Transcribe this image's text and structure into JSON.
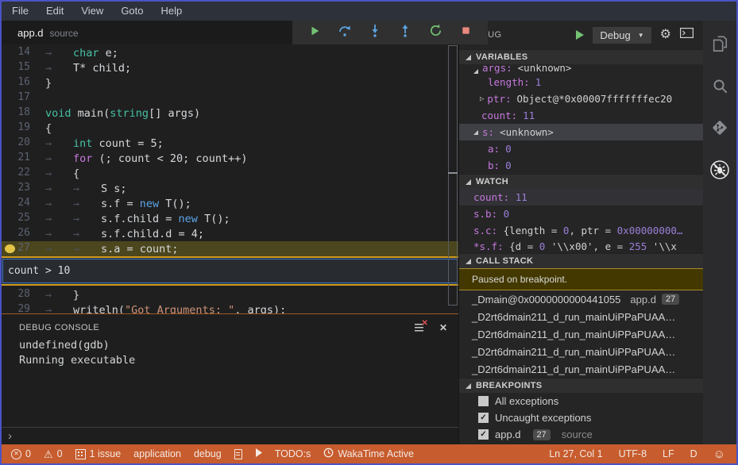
{
  "menubar": {
    "items": [
      "File",
      "Edit",
      "View",
      "Goto",
      "Help"
    ]
  },
  "editor": {
    "tab": {
      "file": "app.d",
      "mode": "source"
    },
    "toolbar_buttons": [
      {
        "name": "continue-button",
        "icon": "debug-continue-icon"
      },
      {
        "name": "step-over-button",
        "icon": "debug-step-over-icon"
      },
      {
        "name": "step-into-button",
        "icon": "debug-step-into-icon"
      },
      {
        "name": "step-out-button",
        "icon": "debug-step-out-icon"
      },
      {
        "name": "restart-button",
        "icon": "debug-restart-icon"
      },
      {
        "name": "stop-button",
        "icon": "debug-stop-icon"
      }
    ],
    "breakpoint_condition": "count > 10",
    "lines": [
      {
        "n": 14,
        "tabs": 1,
        "tokens": [
          {
            "t": "char",
            "c": "type"
          },
          {
            "t": " e;",
            "c": "plain"
          }
        ]
      },
      {
        "n": 15,
        "tabs": 1,
        "tokens": [
          {
            "t": "T* child;",
            "c": "plain"
          }
        ]
      },
      {
        "n": 16,
        "tabs": 0,
        "tokens": [
          {
            "t": "}",
            "c": "plain"
          }
        ]
      },
      {
        "n": 17,
        "tabs": 0,
        "tokens": []
      },
      {
        "n": 18,
        "tabs": 0,
        "tokens": [
          {
            "t": "void",
            "c": "type"
          },
          {
            "t": " main(",
            "c": "plain"
          },
          {
            "t": "string",
            "c": "type"
          },
          {
            "t": "[] args)",
            "c": "plain"
          }
        ]
      },
      {
        "n": 19,
        "tabs": 0,
        "tokens": [
          {
            "t": "{",
            "c": "plain"
          }
        ]
      },
      {
        "n": 20,
        "tabs": 1,
        "tokens": [
          {
            "t": "int",
            "c": "type"
          },
          {
            "t": " count = 5;",
            "c": "plain"
          }
        ]
      },
      {
        "n": 21,
        "tabs": 1,
        "tokens": [
          {
            "t": "for",
            "c": "ctrl"
          },
          {
            "t": " (; count < 20; count++)",
            "c": "plain"
          }
        ]
      },
      {
        "n": 22,
        "tabs": 1,
        "tokens": [
          {
            "t": "{",
            "c": "plain"
          }
        ]
      },
      {
        "n": 23,
        "tabs": 2,
        "tokens": [
          {
            "t": "S s;",
            "c": "plain"
          }
        ]
      },
      {
        "n": 24,
        "tabs": 2,
        "tokens": [
          {
            "t": "s.f = ",
            "c": "plain"
          },
          {
            "t": "new",
            "c": "new"
          },
          {
            "t": " T();",
            "c": "plain"
          }
        ]
      },
      {
        "n": 25,
        "tabs": 2,
        "tokens": [
          {
            "t": "s.f.child = ",
            "c": "plain"
          },
          {
            "t": "new",
            "c": "new"
          },
          {
            "t": " T();",
            "c": "plain"
          }
        ]
      },
      {
        "n": 26,
        "tabs": 2,
        "tokens": [
          {
            "t": "s.f.child.d = 4;",
            "c": "plain"
          }
        ]
      },
      {
        "n": 27,
        "tabs": 2,
        "current": true,
        "breakpoint": true,
        "tokens": [
          {
            "t": "s.a = count;",
            "c": "plain"
          }
        ]
      },
      {
        "n": 28,
        "tabs": 1,
        "tokens": [
          {
            "t": "}",
            "c": "plain"
          }
        ]
      },
      {
        "n": 29,
        "tabs": 1,
        "tokens": [
          {
            "t": "writeln(",
            "c": "plain"
          },
          {
            "t": "\"Got Arguments: \"",
            "c": "str"
          },
          {
            "t": ", args);",
            "c": "plain"
          }
        ]
      }
    ]
  },
  "debug_panel": {
    "title": "DEBUG",
    "configuration": "Debug",
    "variables": {
      "title": "VARIABLES",
      "rows": [
        {
          "name": "args",
          "value": "<unknown>",
          "num": false,
          "indent": 0,
          "twisty": "open",
          "clipped": true
        },
        {
          "name": "length",
          "value": "1",
          "num": true,
          "indent": 1
        },
        {
          "name": "ptr",
          "value": "Object@*0x00007fffffffec20",
          "num": false,
          "indent": 1,
          "twisty": "closed"
        },
        {
          "name": "count",
          "value": "11",
          "num": true,
          "indent": 0
        },
        {
          "name": "s",
          "value": "<unknown>",
          "num": false,
          "indent": 0,
          "twisty": "open",
          "selected": true
        },
        {
          "name": "a",
          "value": "0",
          "num": true,
          "indent": 1
        },
        {
          "name": "b",
          "value": "0",
          "num": true,
          "indent": 1
        }
      ]
    },
    "watch": {
      "title": "WATCH",
      "rows": [
        {
          "name": "count",
          "parts": [
            {
              "t": "11",
              "c": "num"
            }
          ],
          "selected": true
        },
        {
          "name": "s.b",
          "parts": [
            {
              "t": "0",
              "c": "num"
            }
          ]
        },
        {
          "name": "s.c",
          "parts": [
            {
              "t": "{length = ",
              "c": "val"
            },
            {
              "t": "0",
              "c": "num"
            },
            {
              "t": ", ptr = ",
              "c": "val"
            },
            {
              "t": "0x00000000…",
              "c": "num"
            }
          ]
        },
        {
          "name": "*s.f",
          "parts": [
            {
              "t": "{d = ",
              "c": "val"
            },
            {
              "t": "0",
              "c": "num"
            },
            {
              "t": " '\\\\x00', e = ",
              "c": "val"
            },
            {
              "t": "255",
              "c": "num"
            },
            {
              "t": " '\\\\x",
              "c": "val"
            }
          ],
          "clipped": true
        }
      ]
    },
    "call_stack": {
      "title": "CALL STACK",
      "status": "Paused on breakpoint.",
      "frames": [
        {
          "function": "_Dmain@0x0000000000441055",
          "file": "app.d",
          "line": "27"
        },
        {
          "function": "_D2rt6dmain211_d_run_mainUiPPaPUAA…"
        },
        {
          "function": "_D2rt6dmain211_d_run_mainUiPPaPUAA…"
        },
        {
          "function": "_D2rt6dmain211_d_run_mainUiPPaPUAA…"
        },
        {
          "function": "_D2rt6dmain211_d_run_mainUiPPaPUAA…"
        }
      ]
    },
    "breakpoints": {
      "title": "BREAKPOINTS",
      "items": [
        {
          "checked": false,
          "label": "All exceptions"
        },
        {
          "checked": true,
          "label": "Uncaught exceptions"
        },
        {
          "checked": true,
          "label": "app.d",
          "badge": "27",
          "detail": "source"
        }
      ]
    }
  },
  "console": {
    "title": "DEBUG CONSOLE",
    "lines": [
      "undefined(gdb)",
      "Running executable"
    ],
    "prompt": "›"
  },
  "activity_bar": {
    "items": [
      {
        "name": "files-icon",
        "active": false
      },
      {
        "name": "search-icon",
        "active": false
      },
      {
        "name": "git-icon",
        "active": false
      },
      {
        "name": "debug-disabled-icon",
        "active": true
      }
    ]
  },
  "statusbar": {
    "left": [
      {
        "icon": "error-icon",
        "label": "0"
      },
      {
        "icon": "warning-icon",
        "label": "0"
      },
      {
        "icon": "issues-icon",
        "label": "1 issue"
      },
      {
        "label": "application"
      },
      {
        "label": "debug"
      },
      {
        "icon": "file-icon",
        "label": ""
      },
      {
        "icon": "play-icon",
        "label": ""
      },
      {
        "label": "TODO:s"
      },
      {
        "icon": "clock-icon",
        "label": "WakaTime Active"
      }
    ],
    "right": [
      {
        "label": "Ln 27, Col 1"
      },
      {
        "label": "UTF-8"
      },
      {
        "label": "LF"
      },
      {
        "label": "D"
      },
      {
        "icon": "smiley-icon",
        "label": ""
      }
    ]
  },
  "colors": {
    "window_border": "#4953c5",
    "statusbar_bg": "#c75c2e",
    "breakpoint_gold": "#cf9b1d",
    "current_line_bg": "#4b461d",
    "variable_name": "#c678dd",
    "number_value": "#9b7fd6",
    "keyword_type": "#45c0a4",
    "keyword_new": "#5ca5e8",
    "string_literal": "#ce9178"
  }
}
